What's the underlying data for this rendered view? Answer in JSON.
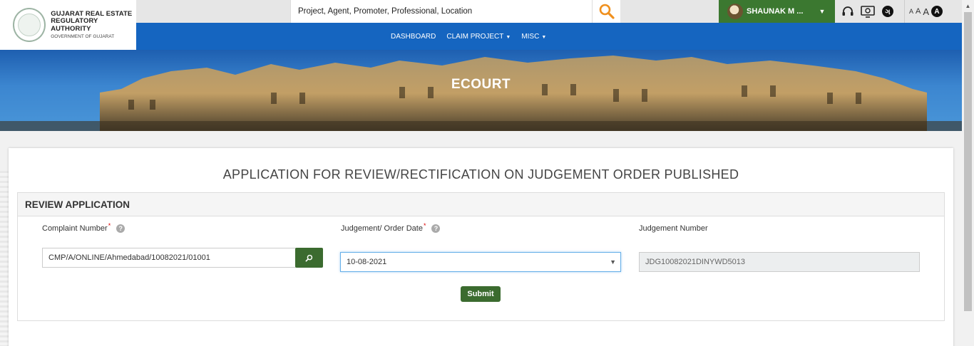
{
  "header": {
    "logo": {
      "line1": "GUJARAT REAL ESTATE",
      "line2": "REGULATORY AUTHORITY",
      "line3": "GOVERNMENT OF GUJARAT"
    },
    "search": {
      "text": "Project, Agent, Promoter, Professional, Location",
      "icon": "search-icon"
    },
    "user": {
      "name": "SHAUNAK M ..."
    },
    "tools": [
      {
        "icon": "headset-icon"
      },
      {
        "icon": "screen-reader-icon"
      },
      {
        "icon": "language-icon"
      }
    ],
    "font_sizes": [
      "A",
      "A",
      "A",
      "A"
    ]
  },
  "nav": {
    "items": [
      {
        "label": "DASHBOARD",
        "has_menu": false
      },
      {
        "label": "CLAIM PROJECT",
        "has_menu": true
      },
      {
        "label": "MISC",
        "has_menu": true
      }
    ]
  },
  "hero": {
    "title": "ECOURT"
  },
  "main": {
    "title": "APPLICATION FOR REVIEW/RECTIFICATION ON JUDGEMENT ORDER PUBLISHED",
    "panel_title": "REVIEW APPLICATION",
    "fields": {
      "complaint": {
        "label": "Complaint Number",
        "value": "CMP/A/ONLINE/Ahmedabad/10082021/01001",
        "help": "?"
      },
      "order_date": {
        "label": "Judgement/ Order Date",
        "value": "10-08-2021",
        "help": "?"
      },
      "judgement_number": {
        "label": "Judgement Number",
        "value": "JDG10082021DINYWD5013"
      }
    },
    "submit_label": "Submit"
  },
  "colors": {
    "brand_green": "#3b7830",
    "nav_blue": "#1565c0",
    "button_green": "#3b6b2f"
  }
}
